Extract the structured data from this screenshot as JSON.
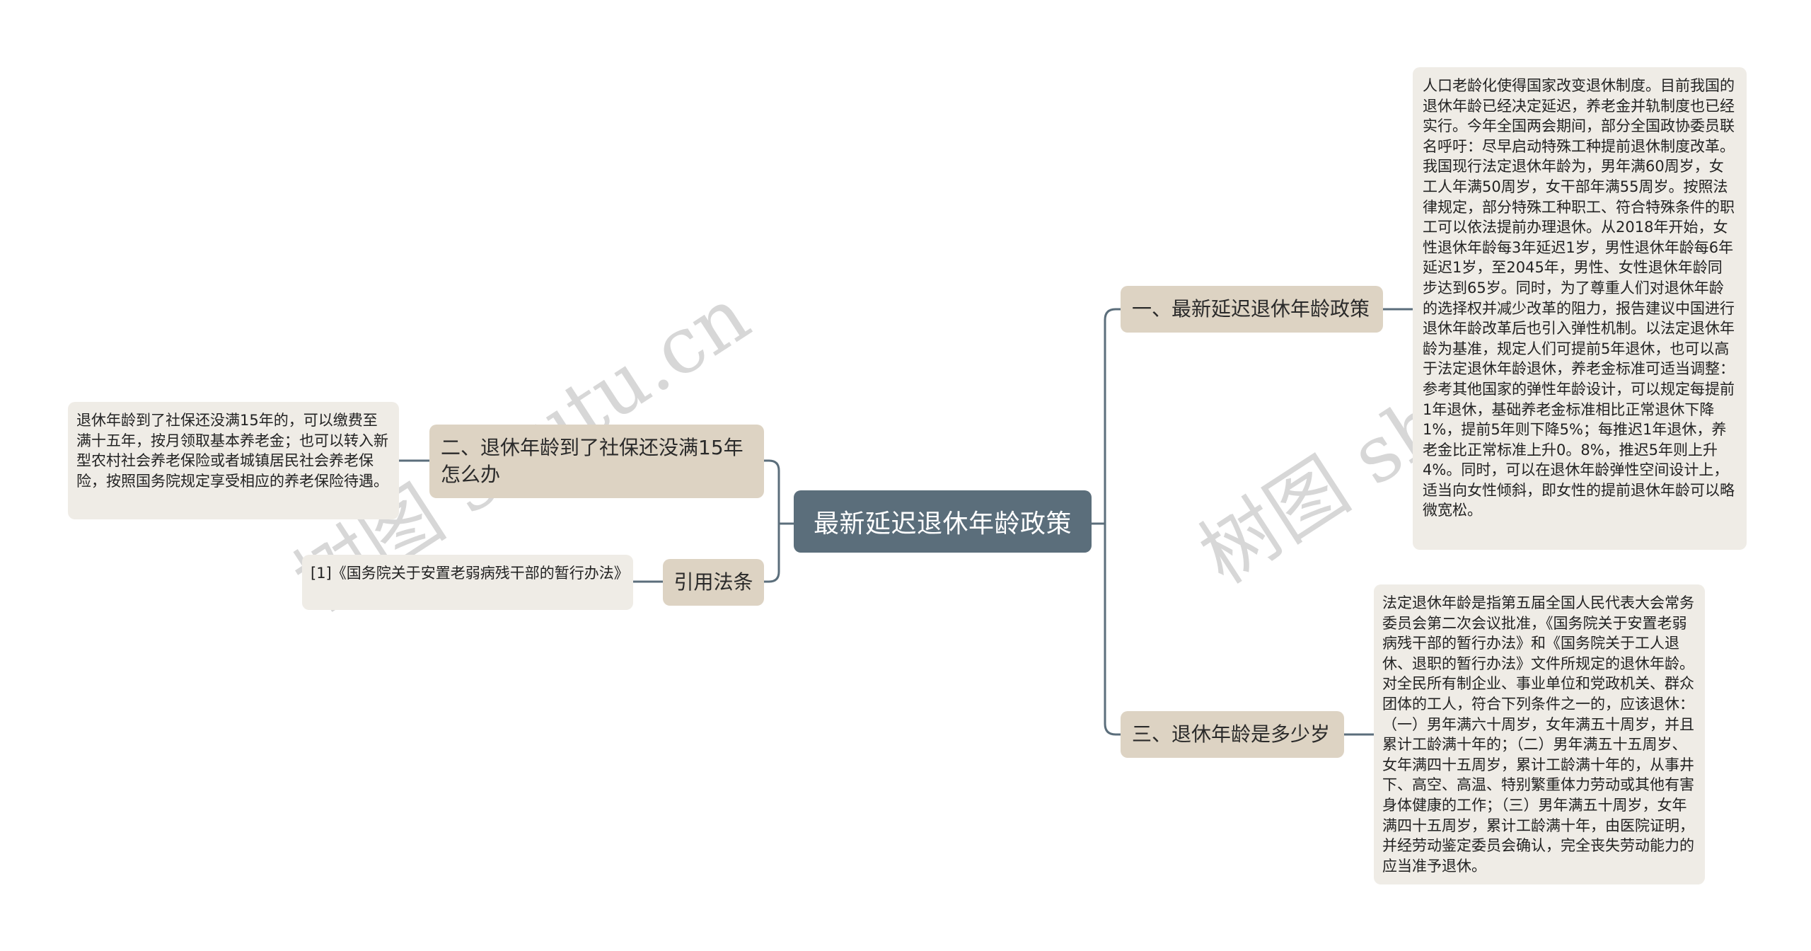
{
  "root": {
    "label": "最新延迟退休年龄政策"
  },
  "branches": [
    {
      "label": "一、最新延迟退休年龄政策",
      "detail": "人口老龄化使得国家改变退休制度。目前我国的退休年龄已经决定延迟，养老金并轨制度也已经实行。今年全国两会期间，部分全国政协委员联名呼吁：尽早启动特殊工种提前退休制度改革。我国现行法定退休年龄为，男年满60周岁，女工人年满50周岁，女干部年满55周岁。按照法律规定，部分特殊工种职工、符合特殊条件的职工可以依法提前办理退休。从2018年开始，女性退休年龄每3年延迟1岁，男性退休年龄每6年延迟1岁，至2045年，男性、女性退休年龄同步达到65岁。同时，为了尊重人们对退休年龄的选择权并减少改革的阻力，报告建议中国进行退休年龄改革后也引入弹性机制。以法定退休年龄为基准，规定人们可提前5年退休，也可以高于法定退休年龄退休，养老金标准可适当调整：参考其他国家的弹性年龄设计，可以规定每提前1年退休，基础养老金标准相比正常退休下降1%，提前5年则下降5%；每推迟1年退休，养老金比正常标准上升0。8%，推迟5年则上升4%。同时，可以在退休年龄弹性空间设计上，适当向女性倾斜，即女性的提前退休年龄可以略微宽松。"
    },
    {
      "label": "三、退休年龄是多少岁",
      "detail": "法定退休年龄是指第五届全国人民代表大会常务委员会第二次会议批准，《国务院关于安置老弱病残干部的暂行办法》和《国务院关于工人退休、退职的暂行办法》文件所规定的退休年龄。对全民所有制企业、事业单位和党政机关、群众团体的工人，符合下列条件之一的，应该退休：（一）男年满六十周岁，女年满五十周岁，并且累计工龄满十年的；（二）男年满五十五周岁、女年满四十五周岁，累计工龄满十年的，从事井下、高空、高温、特别繁重体力劳动或其他有害身体健康的工作；（三）男年满五十周岁，女年满四十五周岁，累计工龄满十年，由医院证明，并经劳动鉴定委员会确认，完全丧失劳动能力的应当准予退休。"
    },
    {
      "label": "二、退休年龄到了社保还没满15年怎么办",
      "detail": "退休年龄到了社保还没满15年的，可以缴费至满十五年，按月领取基本养老金；也可以转入新型农村社会养老保险或者城镇居民社会养老保险，按照国务院规定享受相应的养老保险待遇。"
    },
    {
      "label": "引用法条",
      "detail": "[1]《国务院关于安置老弱病残干部的暂行办法》"
    }
  ],
  "watermarks": [
    "树图 shutu.cn",
    "树图 shutu.cn"
  ],
  "colors": {
    "root_bg": "#5b6e7b",
    "branch_bg": "#ddd3c3",
    "leaf_bg": "#efece6",
    "line": "#5b6e7b"
  }
}
